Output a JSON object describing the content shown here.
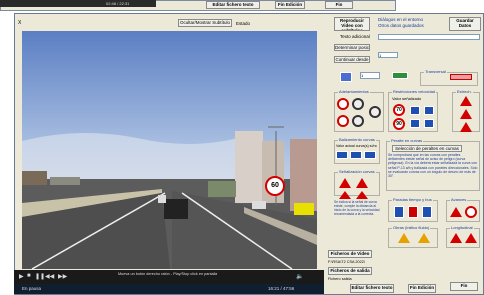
{
  "top_window": {
    "time_text": "02:48 / 22:31",
    "buttons": [
      "Editar fichero texto",
      "Fin Edición",
      "Fin"
    ]
  },
  "main": {
    "close_x": "X",
    "ocultar_subtitulo": "Ocultar/Mostrar Subtítulo",
    "estado_label": "Estado",
    "reproducir_btn": "Reproducir Video con subtítulos",
    "dialog_line1": "Diálogos en el entorno",
    "dialog_line2": "Otros datos guardados",
    "guardar_btn": "Guardar Datos",
    "texto_adicional": "Texto adicional",
    "determinar_btn": "Determinar posición",
    "continuar_btn": "Continuar desde",
    "group_transversal": "Transversal",
    "group_adelantamientos": "Adelantamientos",
    "group_restricciones": "Restricciones velocidad",
    "restricciones_sub": "Valor señalizado",
    "group_estrech": "Estrech.",
    "group_balizamiento": "Balizamiento curvas",
    "balizamiento_sub": "Valor actual curva(s) sí/no",
    "group_peralte": "Peralte en curvas",
    "peralte_btn": "Selección de peraltes en curvas",
    "peralte_text": "Se comprobará que en las curvas con peraltes deficientes existe señal de aviso de peligro (curva peligrosa). En la vía deberá estar señalizada la curva con señal P-13 a/b y balizada con paneles direccionales. Sólo se evaluarán curvas con un ángulo de desvío de más de 30°.",
    "group_senalizacion": "Señalización curvas",
    "senalizacion_note": "Se indica si la señal de curva existe, cumple la distancia al inicio de la curva y la velocidad recomendada a la correcta.",
    "group_paradas": "Paradas tiempo y bus",
    "group_obras": "Obras (tráfico fluido)",
    "group_avances": "Avances",
    "group_longitudinal": "Longitudinal",
    "ficheros_video": "Ficheros de Video",
    "video_path": "F:\\RSA\\T2 CSA 2022\\",
    "ficheros_salida": "Ficheros de salida",
    "salida_path": "Fichero salida",
    "player_hint": "Mueva un botón derecho ratón - Play/Stop click en pantalla",
    "player_time": "16:21 / 47:56",
    "status_left": "En pausa",
    "sign_60": "60",
    "speed_limit_70": "70",
    "speed_limit_90": "90",
    "bottom_buttons": [
      "Editar fichero texto",
      "Fin Edición",
      "Fin"
    ],
    "input_1": "1",
    "input_2": "1"
  }
}
